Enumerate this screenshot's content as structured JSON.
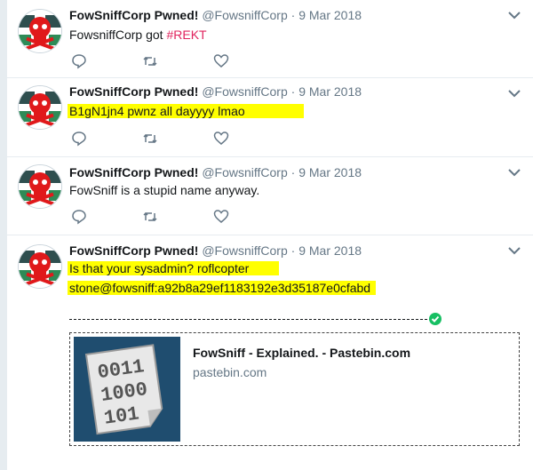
{
  "tweets": [
    {
      "display_name": "FowSniffCorp Pwned!",
      "handle": "@FowsniffCorp",
      "separator": "·",
      "date": "9 Mar 2018",
      "text_main": "FowsniffCorp got ",
      "hashtag": "#REKT"
    },
    {
      "display_name": "FowSniffCorp Pwned!",
      "handle": "@FowsniffCorp",
      "separator": "·",
      "date": "9 Mar 2018",
      "text": "B1gN1jn4 pwnz all dayyyy lmao"
    },
    {
      "display_name": "FowSniffCorp Pwned!",
      "handle": "@FowsniffCorp",
      "separator": "·",
      "date": "9 Mar 2018",
      "text": "FowSniff is a stupid name anyway."
    },
    {
      "display_name": "FowSniffCorp Pwned!",
      "handle": "@FowsniffCorp",
      "separator": "·",
      "date": "9 Mar 2018",
      "text_line1": "Is that your sysadmin? roflcopter",
      "text_line2": "stone@fowsniff:a92b8a29ef1183192e3d35187e0cfabd",
      "card": {
        "title": "FowSniff - Explained. - Pastebin.com",
        "domain": "pastebin.com",
        "image_text": [
          "0011",
          "1000",
          "101"
        ]
      }
    }
  ],
  "colors": {
    "highlight": "#ffff00",
    "hashtag": "#e0245e",
    "avatar_skull": "#e0191b",
    "check": "#17bf63"
  },
  "icons": [
    "skull-avatar-icon",
    "chevron-down-icon",
    "reply-icon",
    "retweet-icon",
    "like-icon",
    "check-circle-icon"
  ]
}
